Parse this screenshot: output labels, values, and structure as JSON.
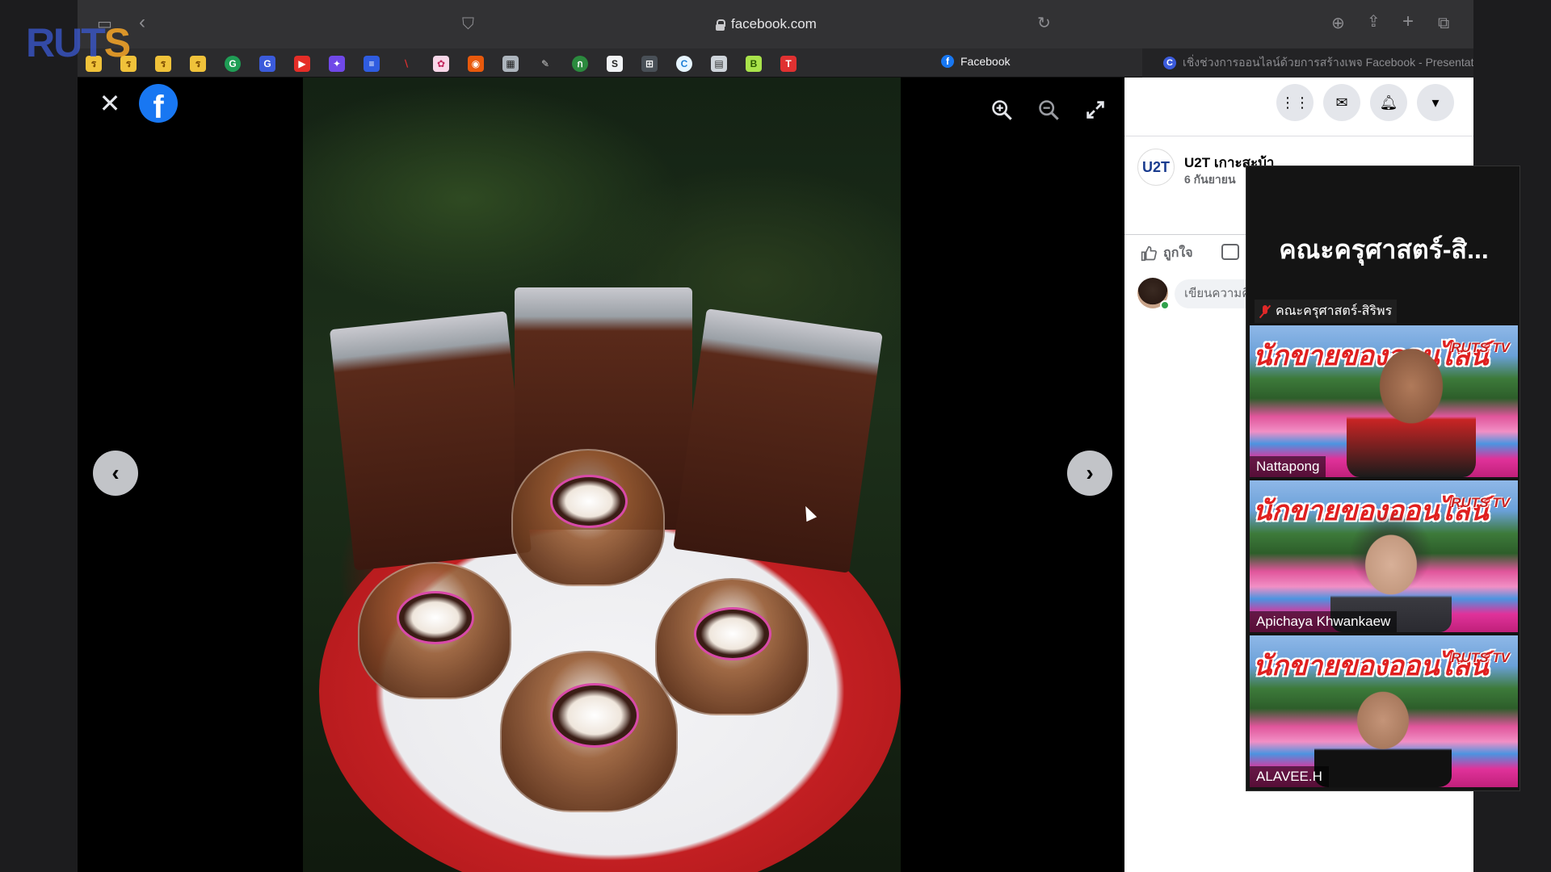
{
  "browser": {
    "url": "facebook.com",
    "active_tab": "Facebook",
    "second_tab": "เชิ่งช่วงการออนไลน์ด้วยการสร้างเพจ Facebook - Presentatio..."
  },
  "overlay_logo": {
    "text_main": "RUT",
    "text_s": "S"
  },
  "viewer": {
    "close_symbol": "✕",
    "fb_letter": "f",
    "prev_symbol": "‹",
    "next_symbol": "›"
  },
  "panel": {
    "page_name": "U2T เกาะสะบ้า",
    "page_date": "6 กันยายน",
    "page_avatar_text": "U2T",
    "like_label": "ถูกใจ",
    "comment_placeholder": "เขียนความคิดเห็น..."
  },
  "meeting": {
    "title": "คณะครุศาสตร์-สิ...",
    "host_label": "คณะครุศาสตร์-สิริพร",
    "banner_text": "นักขายของออนไลน์",
    "tile_logo": "RUTS TV",
    "participants": [
      {
        "name": "Nattapong"
      },
      {
        "name": "Apichaya Khwankaew"
      },
      {
        "name": "ALAVEE.H"
      }
    ]
  },
  "colors": {
    "facebook_blue": "#1877f2",
    "panel_bg": "#ffffff",
    "viewer_bg": "#000000"
  }
}
